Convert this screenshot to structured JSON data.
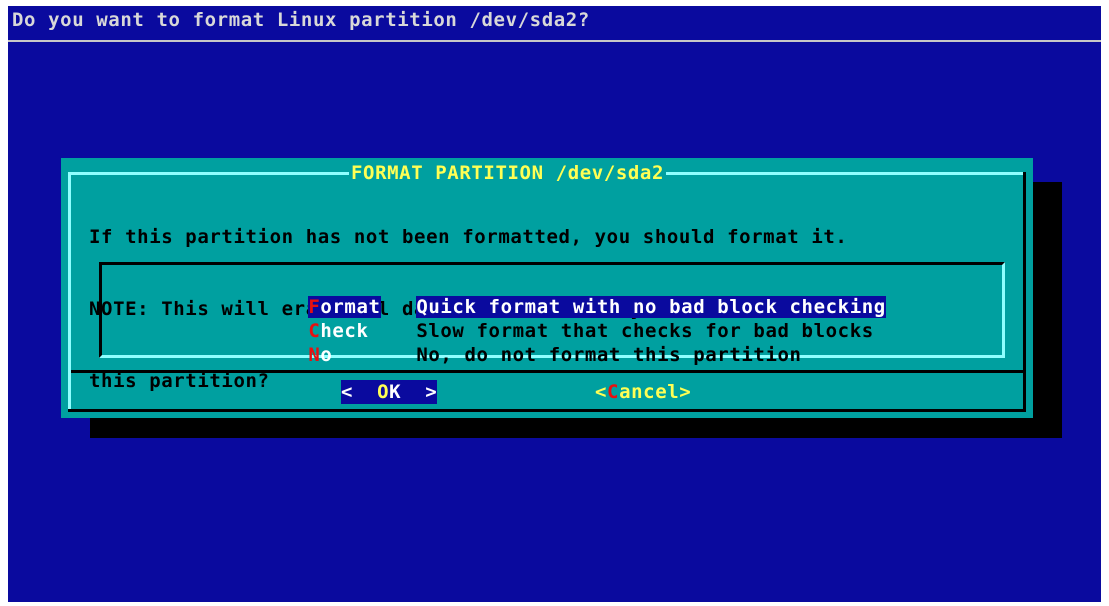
{
  "backtitle": "Do you want to format Linux partition /dev/sda2?",
  "dialog": {
    "title": "FORMAT PARTITION /dev/sda2",
    "body_lines": [
      "If this partition has not been formatted, you should format it.",
      "NOTE: This will erase all data on it.  Would you like to format",
      "this partition?"
    ]
  },
  "menu": {
    "items": [
      {
        "hotkey": "F",
        "tag_rest": "ormat",
        "description": "Quick format with no bad block checking",
        "selected": true
      },
      {
        "hotkey": "C",
        "tag_rest": "heck",
        "description": "Slow format that checks for bad blocks",
        "selected": false
      },
      {
        "hotkey": "N",
        "tag_rest": "o",
        "description": "No, do not format this partition",
        "selected": false
      }
    ]
  },
  "buttons": {
    "ok": {
      "left": "<  ",
      "hot": "O",
      "rest": "K",
      "right": "  >"
    },
    "cancel": {
      "left": "<",
      "hot": "C",
      "rest": "ancel",
      "right": ">"
    }
  },
  "colors": {
    "screen_bg": "#0a0a9e",
    "dialog_bg": "#00a0a0",
    "title_fg": "#ffff54",
    "hotkey_fg": "#e81010",
    "highlight_bg": "#0a0a9e"
  }
}
